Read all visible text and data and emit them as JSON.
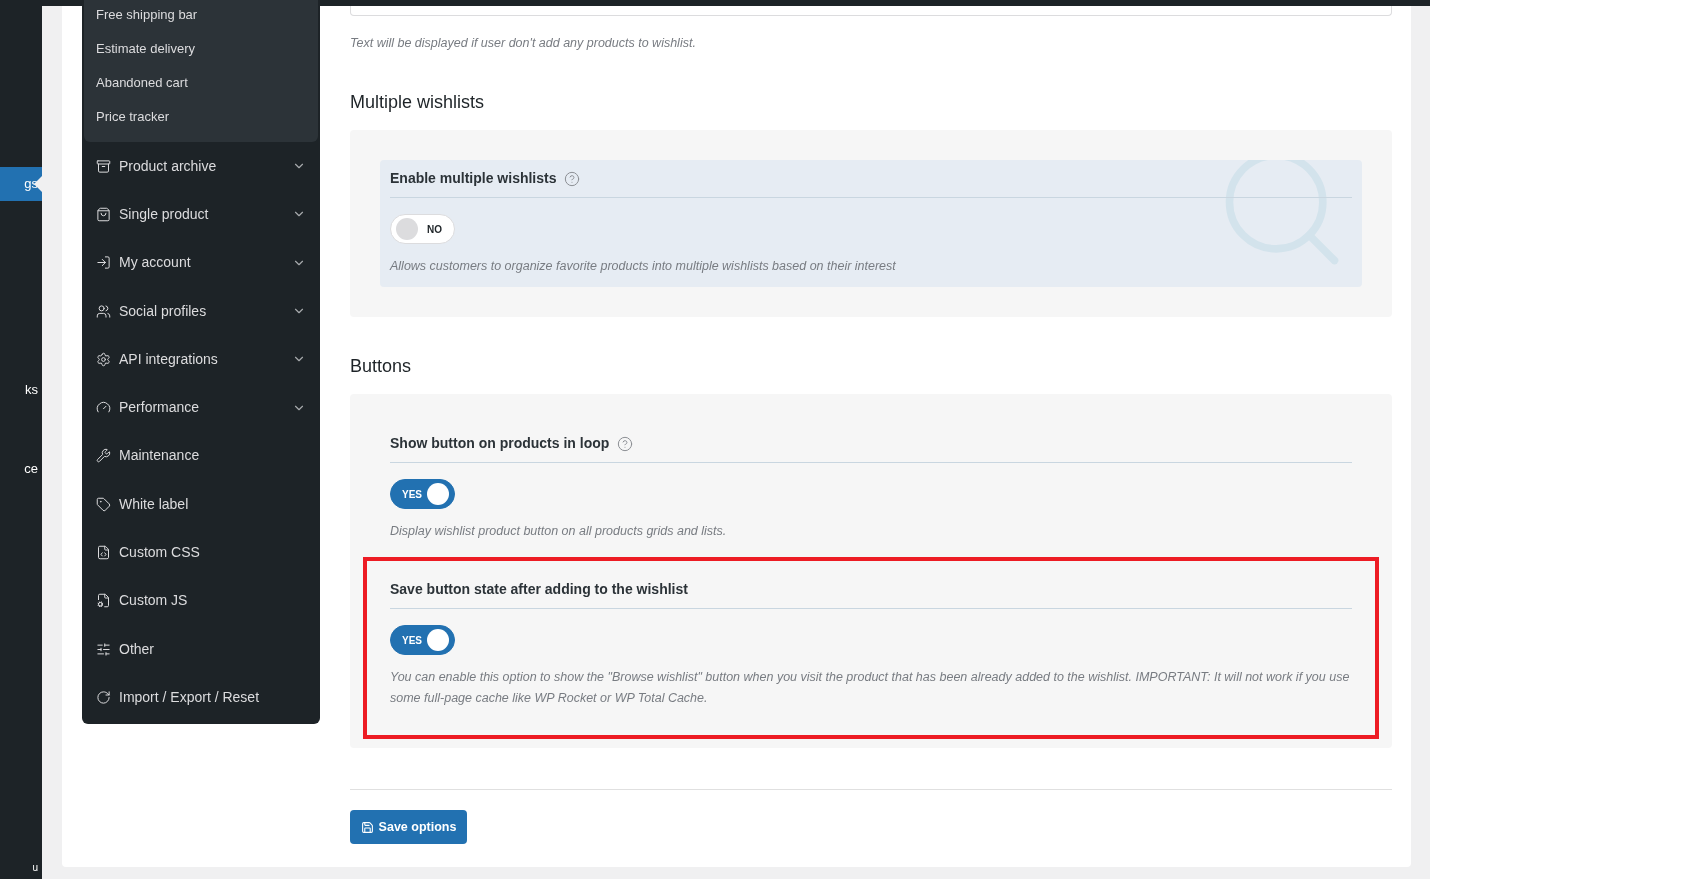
{
  "admin_menu": [
    {
      "label": "gs",
      "selected": true
    },
    {
      "label": "ks",
      "selected": false
    },
    {
      "label": "ce",
      "selected": false
    },
    {
      "label": "u",
      "selected": false
    }
  ],
  "plugin_menu": {
    "submenu": [
      "Free shipping bar",
      "Estimate delivery",
      "Abandoned cart",
      "Price tracker"
    ],
    "items": [
      {
        "label": "Product archive",
        "expandable": true
      },
      {
        "label": "Single product",
        "expandable": true
      },
      {
        "label": "My account",
        "expandable": true
      },
      {
        "label": "Social profiles",
        "expandable": true
      },
      {
        "label": "API integrations",
        "expandable": true
      },
      {
        "label": "Performance",
        "expandable": true
      },
      {
        "label": "Maintenance",
        "expandable": false
      },
      {
        "label": "White label",
        "expandable": false
      },
      {
        "label": "Custom CSS",
        "expandable": false
      },
      {
        "label": "Custom JS",
        "expandable": false
      },
      {
        "label": "Other",
        "expandable": false
      },
      {
        "label": "Import / Export / Reset",
        "expandable": false
      }
    ]
  },
  "textarea_hint": "Text will be displayed if user don't add any products to wishlist.",
  "sections": [
    {
      "title": "Multiple wishlists",
      "settings": [
        {
          "kind": "premium",
          "label": "Enable multiple wishlists",
          "help": true,
          "on": false,
          "toggle_label": "NO",
          "description": "Allows customers to organize favorite products into multiple wishlists based on their interest"
        }
      ]
    },
    {
      "title": "Buttons",
      "settings": [
        {
          "kind": "standard",
          "label": "Show button on products in loop",
          "help": true,
          "on": true,
          "toggle_label": "YES",
          "description": "Display wishlist product button on all products grids and lists."
        },
        {
          "kind": "standard",
          "label": "Save button state after adding to the wishlist",
          "help": false,
          "on": true,
          "toggle_label": "YES",
          "description": "You can enable this option to show the \"Browse wishlist\" button when you visit the product that has been already added to the wishlist. IMPORTANT: It will not work if you use some full-page cache like WP Rocket or WP Total Cache.",
          "highlighted": true
        }
      ]
    }
  ],
  "save_button": "Save options"
}
